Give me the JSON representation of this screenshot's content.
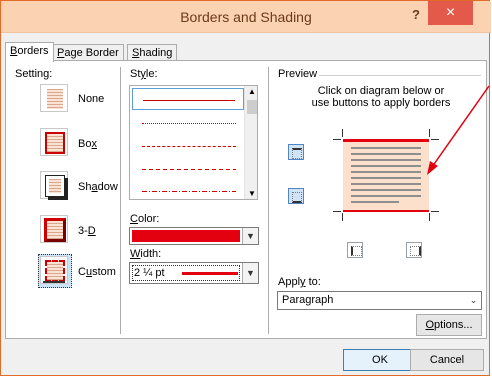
{
  "window": {
    "title": "Borders and Shading",
    "help": "?",
    "close": "×"
  },
  "tabs": [
    {
      "label": "Borders",
      "key": "B",
      "rest": "orders"
    },
    {
      "label": "Page Border",
      "key": "P",
      "rest": "age Border"
    },
    {
      "label": "Shading",
      "key": "S",
      "rest": "hading"
    }
  ],
  "setting": {
    "heading": "Setting:",
    "items": [
      {
        "label": "None"
      },
      {
        "label": "Box",
        "pre": "Bo",
        "key": "x"
      },
      {
        "label": "Shadow",
        "pre": "Sh",
        "key": "a",
        "post": "dow"
      },
      {
        "label": "3-D",
        "pre": "3-",
        "key": "D"
      },
      {
        "label": "Custom",
        "pre": "C",
        "key": "u",
        "post": "stom"
      }
    ],
    "selected": "Custom"
  },
  "style": {
    "heading": "Style:",
    "heading_pre": "St",
    "heading_key": "y",
    "heading_post": "le:",
    "items": [
      "solid",
      "dotted",
      "dashed-small",
      "dashed",
      "dash-dot"
    ],
    "selected": "solid"
  },
  "color": {
    "label": "Color:",
    "key": "C",
    "rest": "olor:",
    "value_color": "#e3000f"
  },
  "width": {
    "label": "Width:",
    "key": "W",
    "rest": "idth:",
    "value": "2 ¼ pt"
  },
  "preview": {
    "heading": "Preview",
    "instructions_line1": "Click on diagram below or",
    "instructions_line2": "use buttons to apply borders"
  },
  "apply_to": {
    "label": "Apply to:",
    "pre": "Appl",
    "key": "y",
    "post": " to:",
    "value": "Paragraph"
  },
  "buttons": {
    "options": "Options...",
    "options_key": "O",
    "options_rest": "ptions...",
    "ok": "OK",
    "cancel": "Cancel"
  },
  "colors": {
    "accent_red": "#e3000f",
    "titlebar": "#fbd3b2",
    "close": "#e35a4a"
  }
}
